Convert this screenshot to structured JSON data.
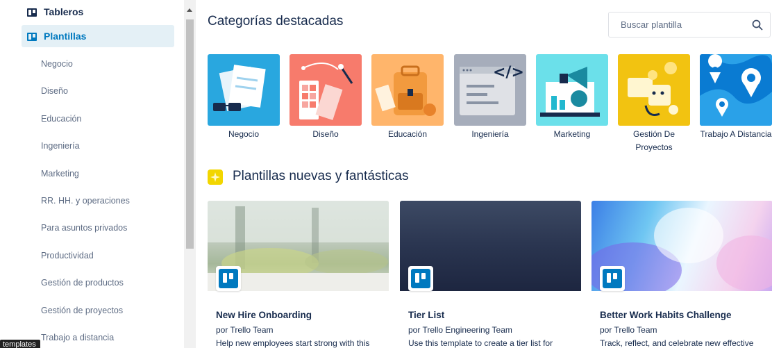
{
  "sidebar": {
    "boards_label": "Tableros",
    "templates_label": "Plantillas",
    "categories": [
      "Negocio",
      "Diseño",
      "Educación",
      "Ingeniería",
      "Marketing",
      "RR. HH. y operaciones",
      "Para asuntos privados",
      "Productividad",
      "Gestión de productos",
      "Gestión de proyectos",
      "Trabajo a distancia"
    ],
    "tooltip": "templates"
  },
  "featured": {
    "title": "Categorías destacadas",
    "search_placeholder": "Buscar plantilla",
    "categories": [
      {
        "label": "Negocio",
        "color": "#29a7df"
      },
      {
        "label": "Diseño",
        "color": "#f77b6c"
      },
      {
        "label": "Educación",
        "color": "#ffb56b"
      },
      {
        "label": "Ingeniería",
        "color": "#a6adbb"
      },
      {
        "label": "Marketing",
        "color": "#6be0ea"
      },
      {
        "label": "Gestión De Proyectos",
        "color": "#f2c311"
      },
      {
        "label": "Trabajo A Distancia",
        "color": "#0a7bd2"
      }
    ]
  },
  "new_templates": {
    "title": "Plantillas nuevas y fantásticas",
    "cards": [
      {
        "name": "New Hire Onboarding",
        "by": "por Trello Team",
        "desc": "Help new employees start strong with this"
      },
      {
        "name": "Tier List",
        "by": "por Trello Engineering Team",
        "desc": "Use this template to create a tier list for"
      },
      {
        "name": "Better Work Habits Challenge",
        "by": "por Trello Team",
        "desc": "Track, reflect, and celebrate new effective"
      }
    ]
  }
}
